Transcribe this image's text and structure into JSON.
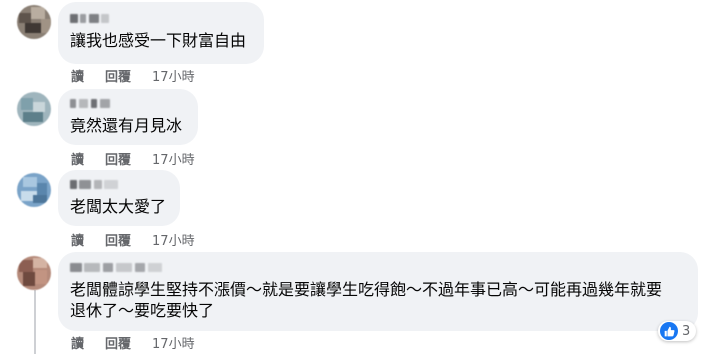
{
  "comments": [
    {
      "text": "讓我也感受一下財富自由",
      "actions": {
        "read": "讀",
        "reply": "回覆",
        "time": "17小時"
      }
    },
    {
      "text": "竟然還有月見冰",
      "actions": {
        "read": "讀",
        "reply": "回覆",
        "time": "17小時"
      }
    },
    {
      "text": "老闆太大愛了",
      "actions": {
        "read": "讀",
        "reply": "回覆",
        "time": "17小時"
      }
    },
    {
      "text": "老闆體諒學生堅持不漲價～就是要讓學生吃得飽～不過年事已高～可能再過幾年就要\n退休了～要吃要快了",
      "actions": {
        "read": "讀",
        "reply": "回覆",
        "time": "17小時"
      },
      "reaction": {
        "icon": "like-icon",
        "count": "3",
        "color": "#1877f2"
      }
    }
  ]
}
